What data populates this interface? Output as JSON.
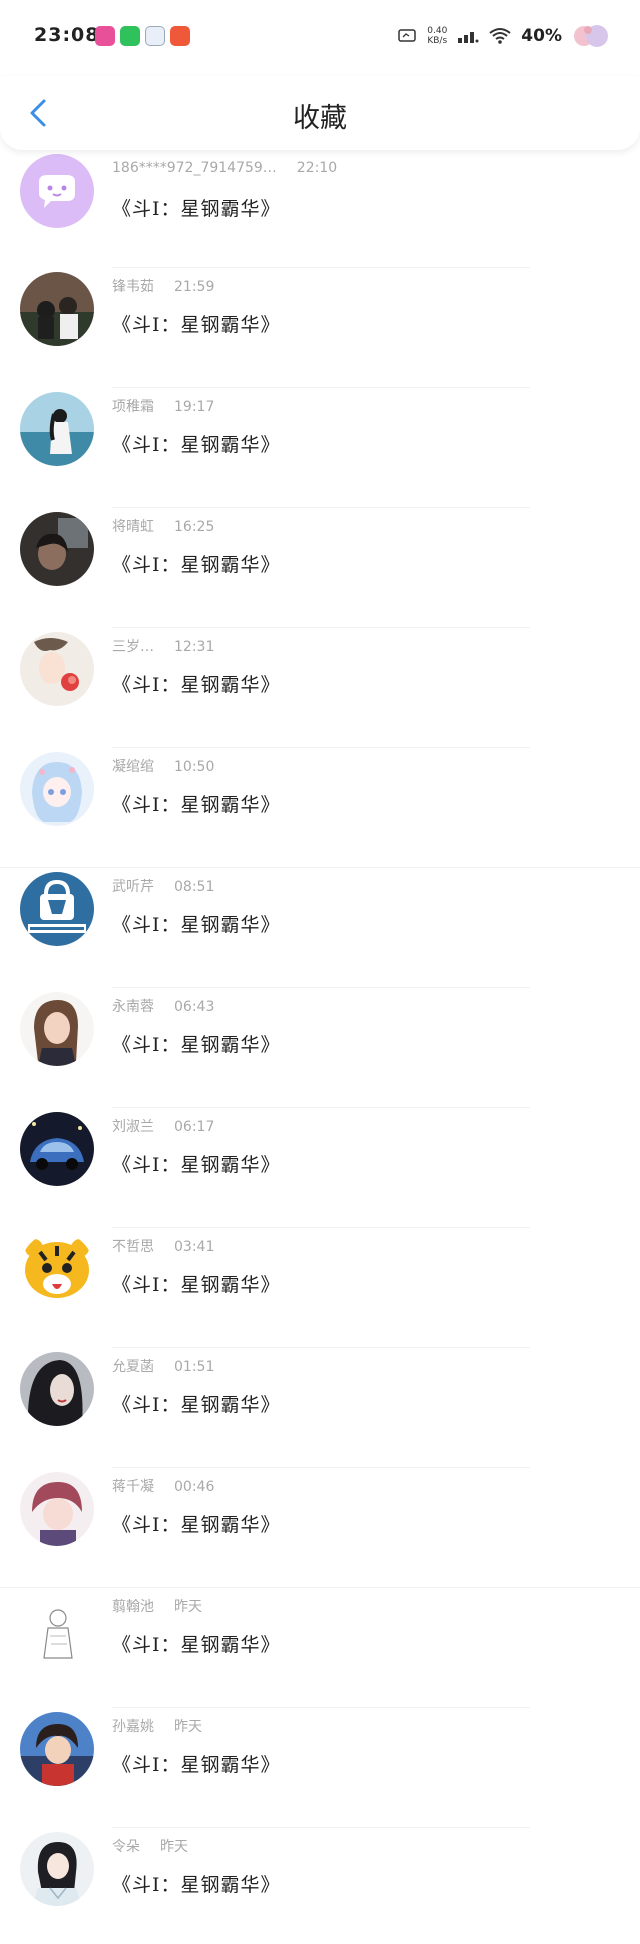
{
  "status_bar": {
    "time": "23:08",
    "network_speed": "0.40",
    "network_unit": "KB/s",
    "battery": "40%"
  },
  "header": {
    "title": "收藏"
  },
  "items": [
    {
      "name": "186****972_7914759…",
      "time": "22:10",
      "message": "《斗I：星钢霸华》",
      "avatar": "purple-chat-icon"
    },
    {
      "name": "锋韦茹",
      "time": "21:59",
      "message": "《斗I：星钢霸华》",
      "avatar": "couple-photo"
    },
    {
      "name": "项稚霜",
      "time": "19:17",
      "message": "《斗I：星钢霸华》",
      "avatar": "girl-by-sea"
    },
    {
      "name": "将晴虹",
      "time": "16:25",
      "message": "《斗I：星钢霸华》",
      "avatar": "dark-portrait"
    },
    {
      "name": "三岁…",
      "time": "12:31",
      "message": "《斗I：星钢霸华》",
      "avatar": "anime-boy-flower"
    },
    {
      "name": "凝绾绾",
      "time": "10:50",
      "message": "《斗I：星钢霸华》",
      "avatar": "anime-girl-blue"
    },
    {
      "name": "武听芹",
      "time": "08:51",
      "message": "《斗I：星钢霸华》",
      "avatar": "bullocked-logo"
    },
    {
      "name": "永南蓉",
      "time": "06:43",
      "message": "《斗I：星钢霸华》",
      "avatar": "woman-portrait"
    },
    {
      "name": "刘淑兰",
      "time": "06:17",
      "message": "《斗I：星钢霸华》",
      "avatar": "blue-car"
    },
    {
      "name": "不哲思",
      "time": "03:41",
      "message": "《斗I：星钢霸华》",
      "avatar": "cartoon-tiger"
    },
    {
      "name": "允夏菡",
      "time": "01:51",
      "message": "《斗I：星钢霸华》",
      "avatar": "dark-hair-girl"
    },
    {
      "name": "蒋千凝",
      "time": "00:46",
      "message": "《斗I：星钢霸华》",
      "avatar": "anime-red-hair"
    },
    {
      "name": "翦翰池",
      "time": "昨天",
      "message": "《斗I：星钢霸华》",
      "avatar": "line-sketch"
    },
    {
      "name": "孙嘉姚",
      "time": "昨天",
      "message": "《斗I：星钢霸华》",
      "avatar": "anime-warrior"
    },
    {
      "name": "令朵",
      "time": "昨天",
      "message": "《斗I：星钢霸华》",
      "avatar": "hanfu-girl"
    }
  ],
  "colors": {
    "accent_blue": "#3a8ee6",
    "name_gray": "#a9a9a9",
    "avatar_purple": "#d9b8f5"
  }
}
